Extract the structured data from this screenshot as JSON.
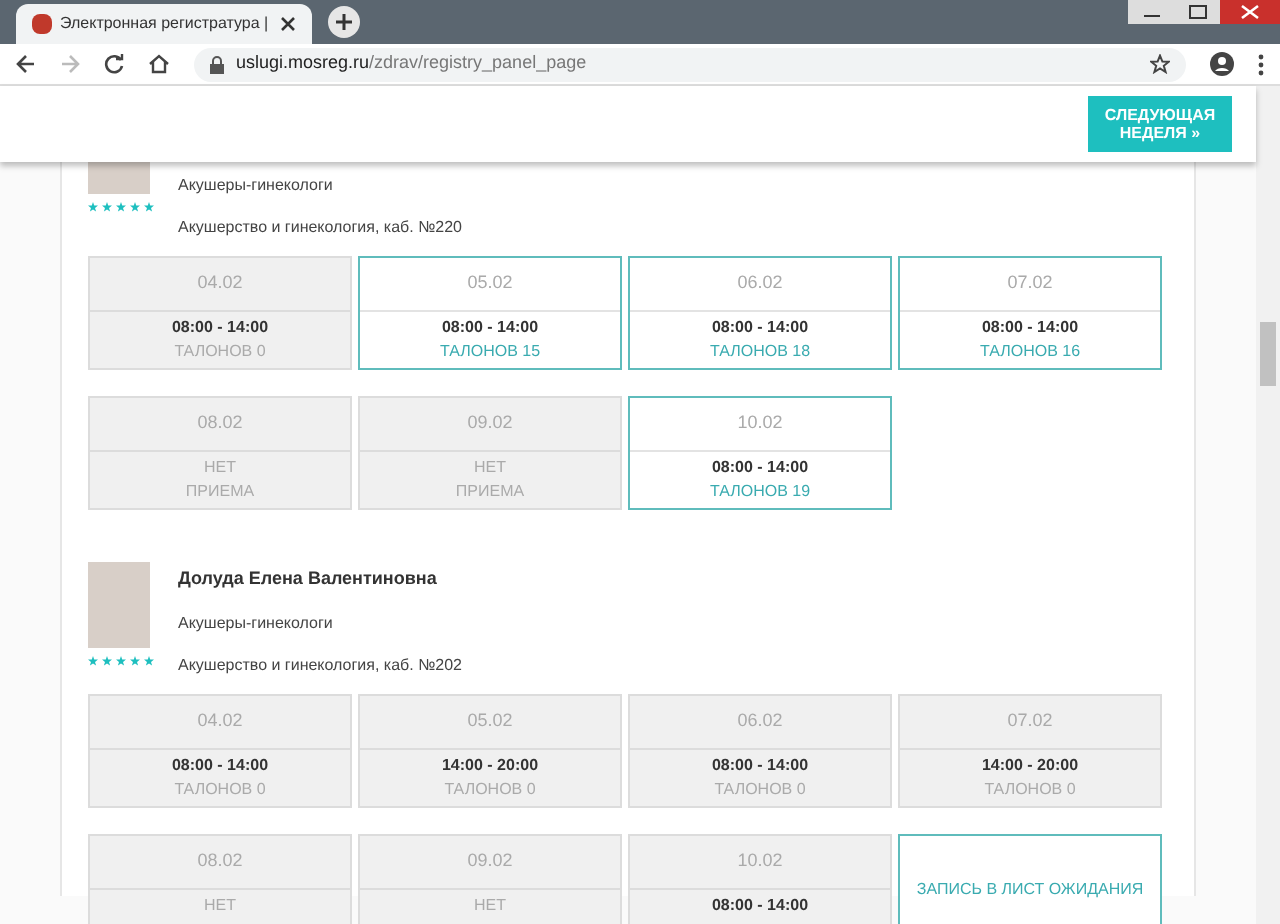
{
  "browser": {
    "tab_title": "Электронная регистратура |",
    "url_host": "uslugi.mosreg.ru",
    "url_path": "/zdrav/registry_panel_page"
  },
  "header": {
    "next_week_button": "СЛЕДУЮЩАЯ НЕДЕЛЯ »"
  },
  "doctors": [
    {
      "specialty": "Акушеры-гинекологи",
      "department": "Акушерство и гинекология, каб. №220",
      "stars": 5,
      "days": [
        {
          "date": "04.02",
          "kind": "closed",
          "time": "08:00 - 14:00",
          "talons": "ТАЛОНОВ 0"
        },
        {
          "date": "05.02",
          "kind": "available",
          "time": "08:00 - 14:00",
          "talons": "ТАЛОНОВ 15"
        },
        {
          "date": "06.02",
          "kind": "available",
          "time": "08:00 - 14:00",
          "talons": "ТАЛОНОВ 18"
        },
        {
          "date": "07.02",
          "kind": "available",
          "time": "08:00 - 14:00",
          "talons": "ТАЛОНОВ 16"
        },
        {
          "date": "08.02",
          "kind": "no_reception",
          "line_1": "НЕТ",
          "line_2": "ПРИЕМА"
        },
        {
          "date": "09.02",
          "kind": "no_reception",
          "line_1": "НЕТ",
          "line_2": "ПРИЕМА"
        },
        {
          "date": "10.02",
          "kind": "available",
          "time": "08:00 - 14:00",
          "talons": "ТАЛОНОВ 19"
        }
      ]
    },
    {
      "name": "Долуда Елена Валентиновна",
      "specialty": "Акушеры-гинекологи",
      "department": "Акушерство и гинекология, каб. №202",
      "stars": 5,
      "days": [
        {
          "date": "04.02",
          "kind": "closed",
          "time": "08:00 - 14:00",
          "talons": "ТАЛОНОВ 0"
        },
        {
          "date": "05.02",
          "kind": "closed",
          "time": "14:00 - 20:00",
          "talons": "ТАЛОНОВ 0"
        },
        {
          "date": "06.02",
          "kind": "closed",
          "time": "08:00 - 14:00",
          "talons": "ТАЛОНОВ 0"
        },
        {
          "date": "07.02",
          "kind": "closed",
          "time": "14:00 - 20:00",
          "talons": "ТАЛОНОВ 0"
        },
        {
          "date": "08.02",
          "kind": "no_reception",
          "line_1": "НЕТ"
        },
        {
          "date": "09.02",
          "kind": "no_reception",
          "line_1": "НЕТ"
        },
        {
          "date": "10.02",
          "kind": "closed",
          "time": "08:00 - 14:00"
        },
        {
          "kind": "waitlist",
          "label": "ЗАПИСЬ В ЛИСТ ОЖИДАНИЯ"
        }
      ]
    }
  ]
}
